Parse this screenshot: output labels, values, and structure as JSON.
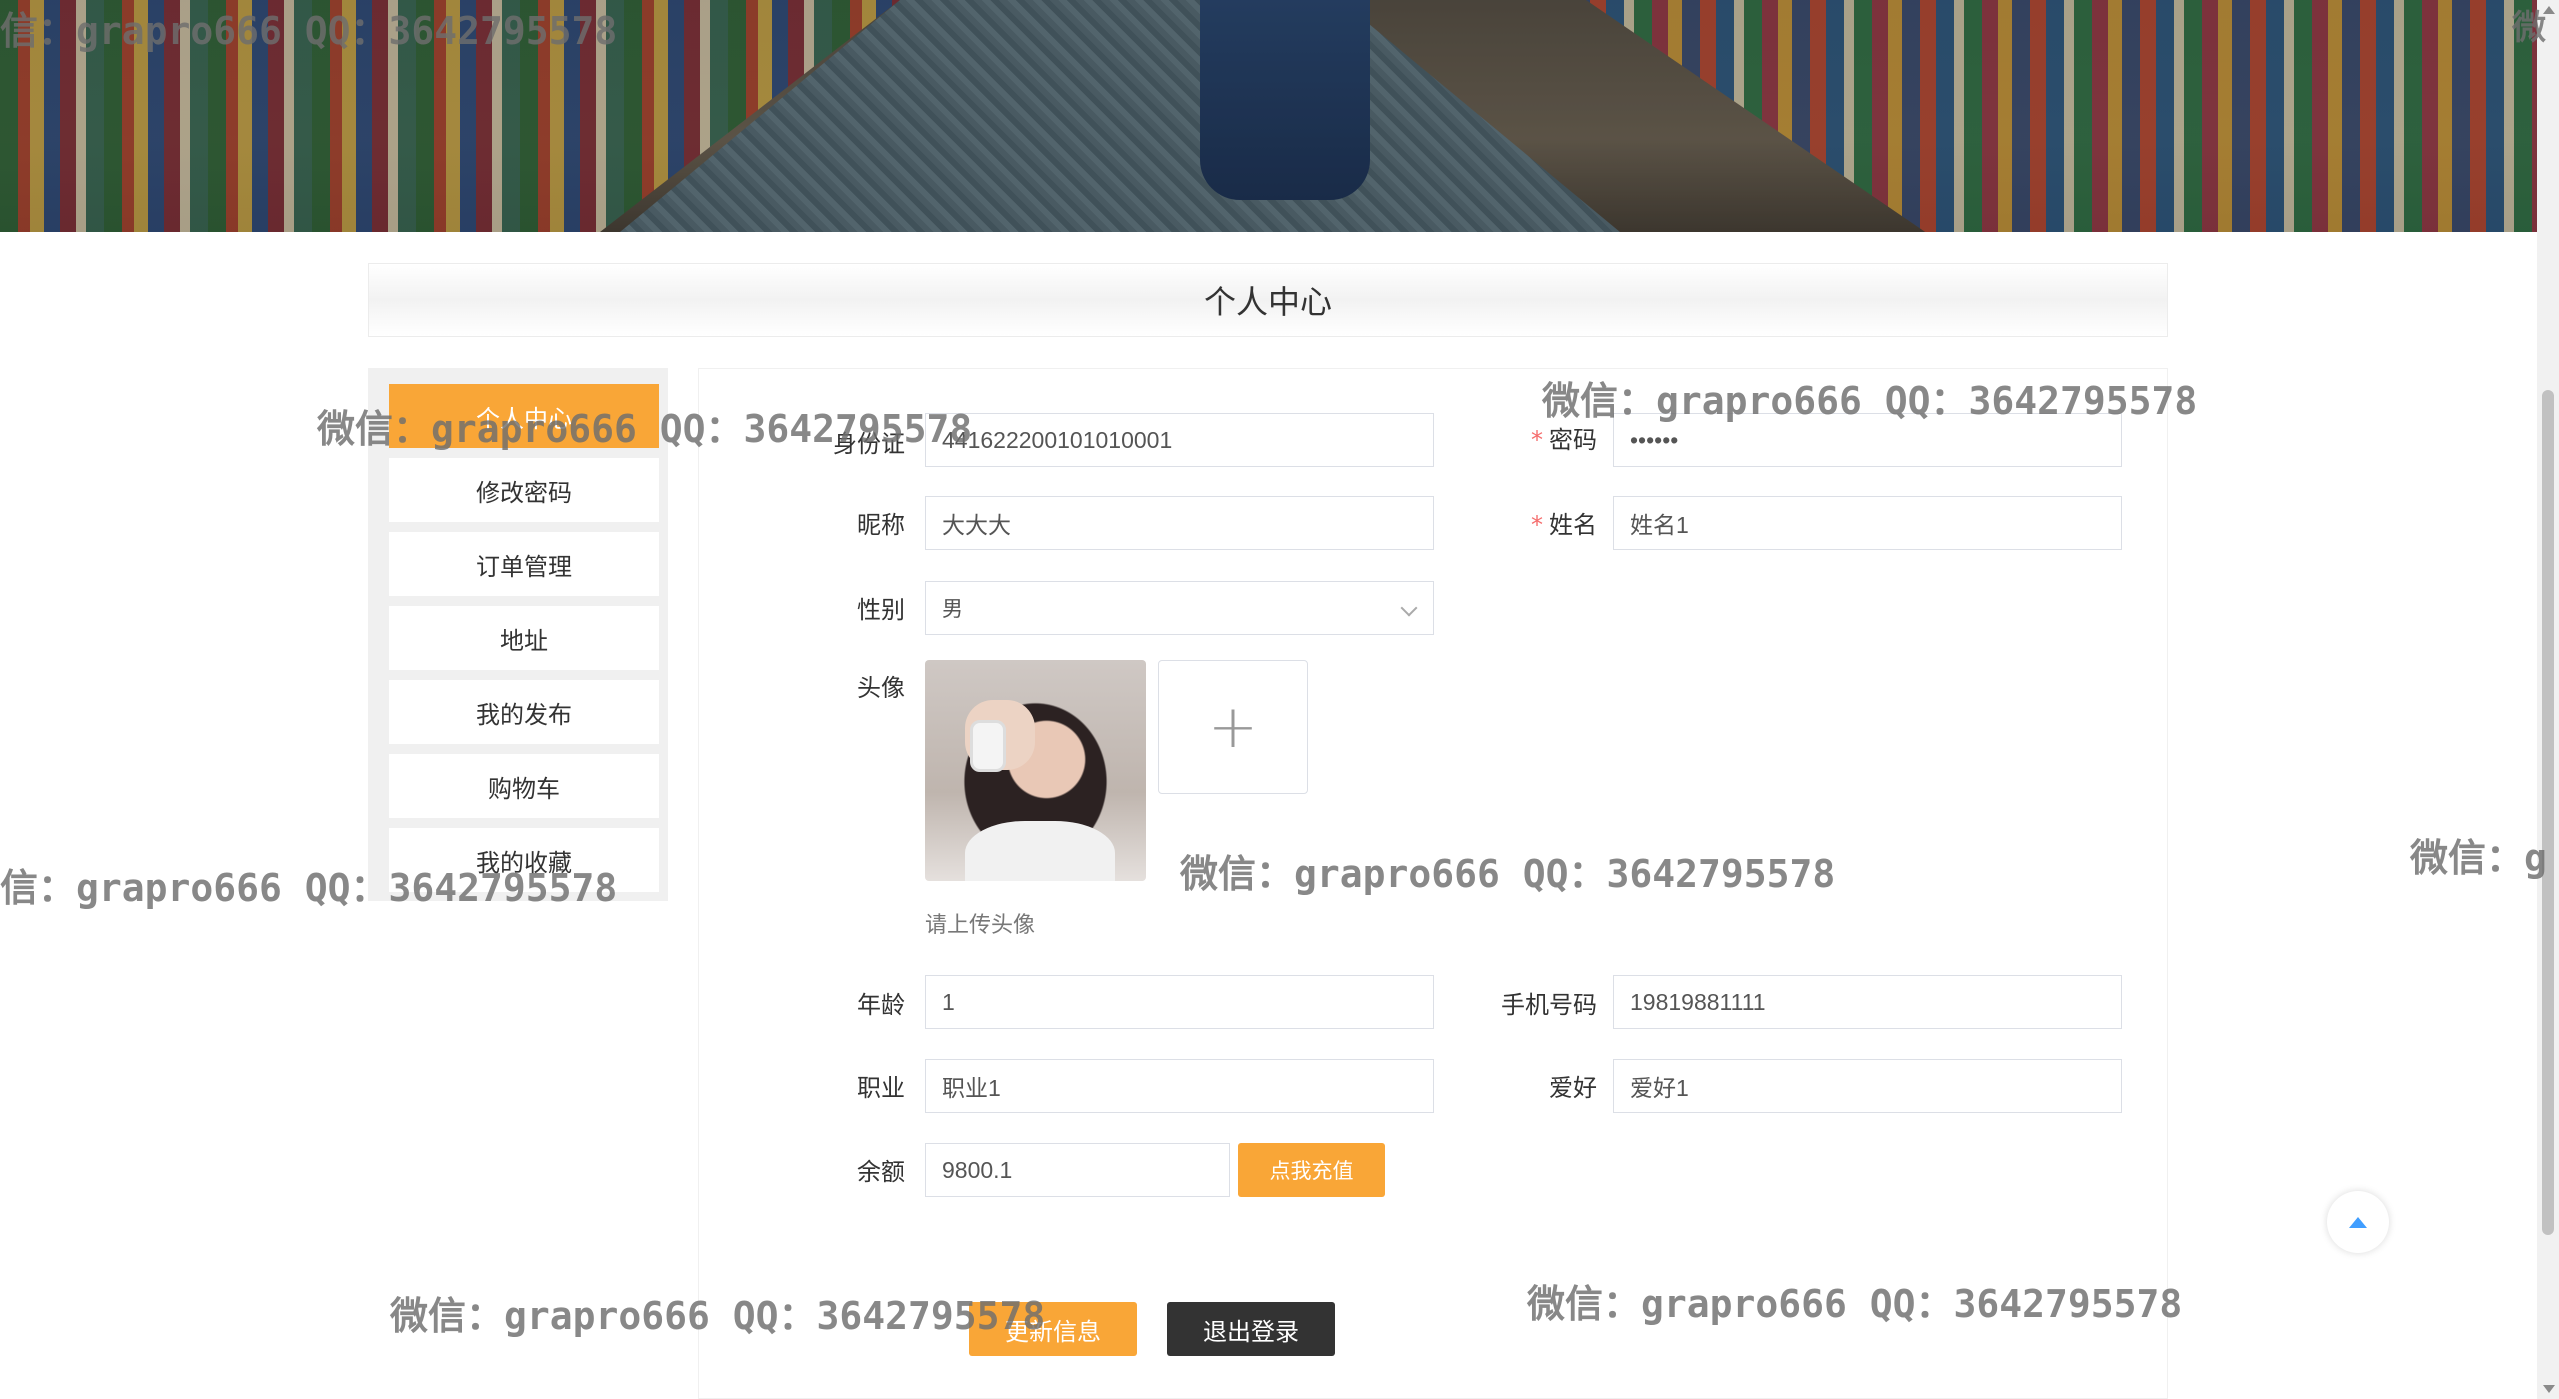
{
  "page": {
    "title": "个人中心"
  },
  "watermark": {
    "text": "微信：grapro666 QQ：3642795578",
    "partial_left": "信：grapro666 QQ：3642795578",
    "partial_right_1": "微信：g",
    "partial_right_2": "微"
  },
  "sidebar": {
    "items": [
      {
        "label": "个人中心",
        "active": true
      },
      {
        "label": "修改密码",
        "active": false
      },
      {
        "label": "订单管理",
        "active": false
      },
      {
        "label": "地址",
        "active": false
      },
      {
        "label": "我的发布",
        "active": false
      },
      {
        "label": "购物车",
        "active": false
      },
      {
        "label": "我的收藏",
        "active": false
      }
    ]
  },
  "form": {
    "id_card": {
      "label": "身份证",
      "value": "441622200101010001"
    },
    "password": {
      "label": "密码",
      "value": "••••••",
      "required": true
    },
    "nickname": {
      "label": "昵称",
      "value": "大大大"
    },
    "name": {
      "label": "姓名",
      "value": "姓名1",
      "required": true
    },
    "gender": {
      "label": "性别",
      "value": "男"
    },
    "avatar": {
      "label": "头像",
      "tip": "请上传头像",
      "upload_icon": "plus-icon",
      "upload_symbol": "+"
    },
    "age": {
      "label": "年龄",
      "value": "1"
    },
    "phone": {
      "label": "手机号码",
      "value": "19819881111"
    },
    "job": {
      "label": "职业",
      "value": "职业1"
    },
    "hobby": {
      "label": "爱好",
      "value": "爱好1"
    },
    "balance": {
      "label": "余额",
      "value": "9800.1"
    },
    "required_mark": "*"
  },
  "buttons": {
    "recharge": "点我充值",
    "update": "更新信息",
    "logout": "退出登录"
  },
  "colors": {
    "accent": "#f9a637",
    "dark": "#333333",
    "required": "#f56c6c",
    "backtop_arrow": "#409eff"
  }
}
